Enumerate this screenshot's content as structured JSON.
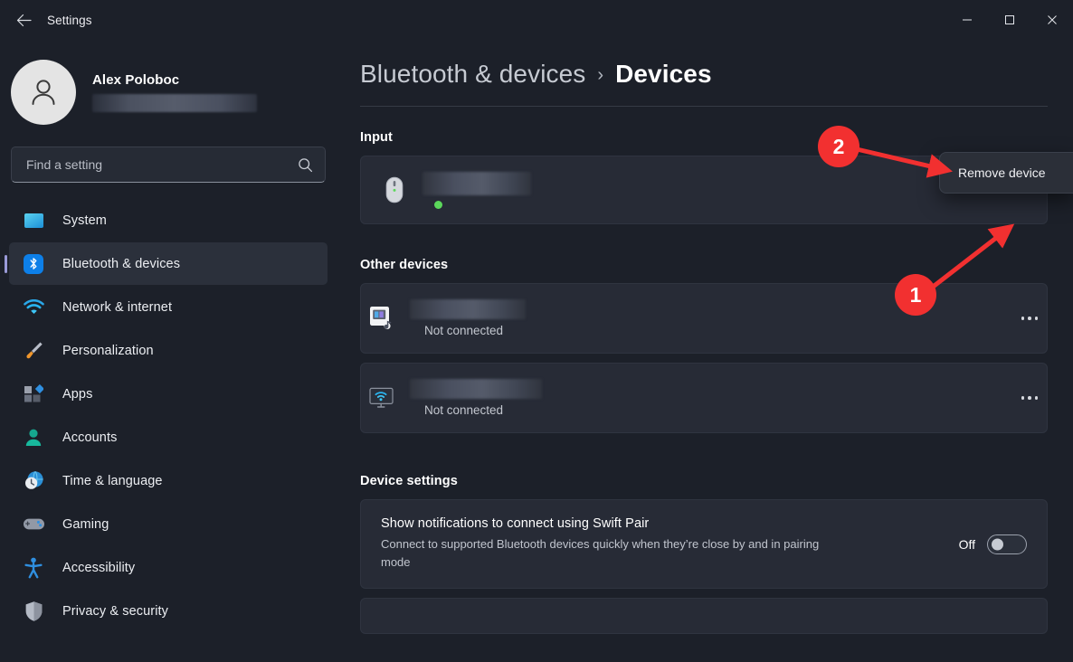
{
  "window": {
    "title": "Settings",
    "back_icon": "back-arrow-icon",
    "minimize_label": "Minimize",
    "maximize_label": "Maximize",
    "close_label": "Close"
  },
  "account": {
    "name": "Alex Poloboc",
    "email_redacted": true
  },
  "search": {
    "placeholder": "Find a setting",
    "value": "",
    "icon": "search-icon"
  },
  "sidebar": {
    "items": [
      {
        "label": "System",
        "icon": "monitor-icon",
        "active": false
      },
      {
        "label": "Bluetooth & devices",
        "icon": "bluetooth-icon",
        "active": true
      },
      {
        "label": "Network & internet",
        "icon": "wifi-icon",
        "active": false
      },
      {
        "label": "Personalization",
        "icon": "paintbrush-icon",
        "active": false
      },
      {
        "label": "Apps",
        "icon": "apps-grid-icon",
        "active": false
      },
      {
        "label": "Accounts",
        "icon": "person-icon",
        "active": false
      },
      {
        "label": "Time & language",
        "icon": "clock-globe-icon",
        "active": false
      },
      {
        "label": "Gaming",
        "icon": "gamepad-icon",
        "active": false
      },
      {
        "label": "Accessibility",
        "icon": "accessibility-person-icon",
        "active": false
      },
      {
        "label": "Privacy & security",
        "icon": "shield-icon",
        "active": false
      }
    ]
  },
  "breadcrumb": {
    "parent": "Bluetooth & devices",
    "separator": "›",
    "current": "Devices"
  },
  "sections": {
    "input": {
      "title": "Input",
      "devices": [
        {
          "icon": "mouse-icon",
          "name_redacted": true,
          "status": "connected",
          "status_dot_color": "#5bd75b",
          "menu_icon": "ellipsis-icon"
        }
      ]
    },
    "other_devices": {
      "title": "Other devices",
      "devices": [
        {
          "icon": "media-device-icon",
          "name_redacted": true,
          "status": "Not connected",
          "menu_icon": "ellipsis-icon"
        },
        {
          "icon": "wireless-display-icon",
          "name_redacted": true,
          "status": "Not connected",
          "menu_icon": "ellipsis-icon"
        }
      ]
    },
    "device_settings": {
      "title": "Device settings",
      "items": [
        {
          "title": "Show notifications to connect using Swift Pair",
          "description": "Connect to supported Bluetooth devices quickly when they’re close by and in pairing mode",
          "toggle_state": "Off",
          "toggle_on": false
        }
      ]
    }
  },
  "context_menu": {
    "items": [
      {
        "label": "Remove device"
      }
    ]
  },
  "annotations": {
    "accent_color": "#f23030",
    "markers": [
      {
        "id": "1",
        "label": "1",
        "points_to": "ellipsis-menu-input-device"
      },
      {
        "id": "2",
        "label": "2",
        "points_to": "remove-device-menu-item"
      }
    ]
  },
  "colors": {
    "page_background": "#1c2029",
    "card_background": "#272b36",
    "sidebar_selected": "#2b303b",
    "accent_pill": "#9a9ad8",
    "bluetooth_blue": "#0d7fe8",
    "annotation_red": "#f23030",
    "status_green": "#5bd75b"
  }
}
